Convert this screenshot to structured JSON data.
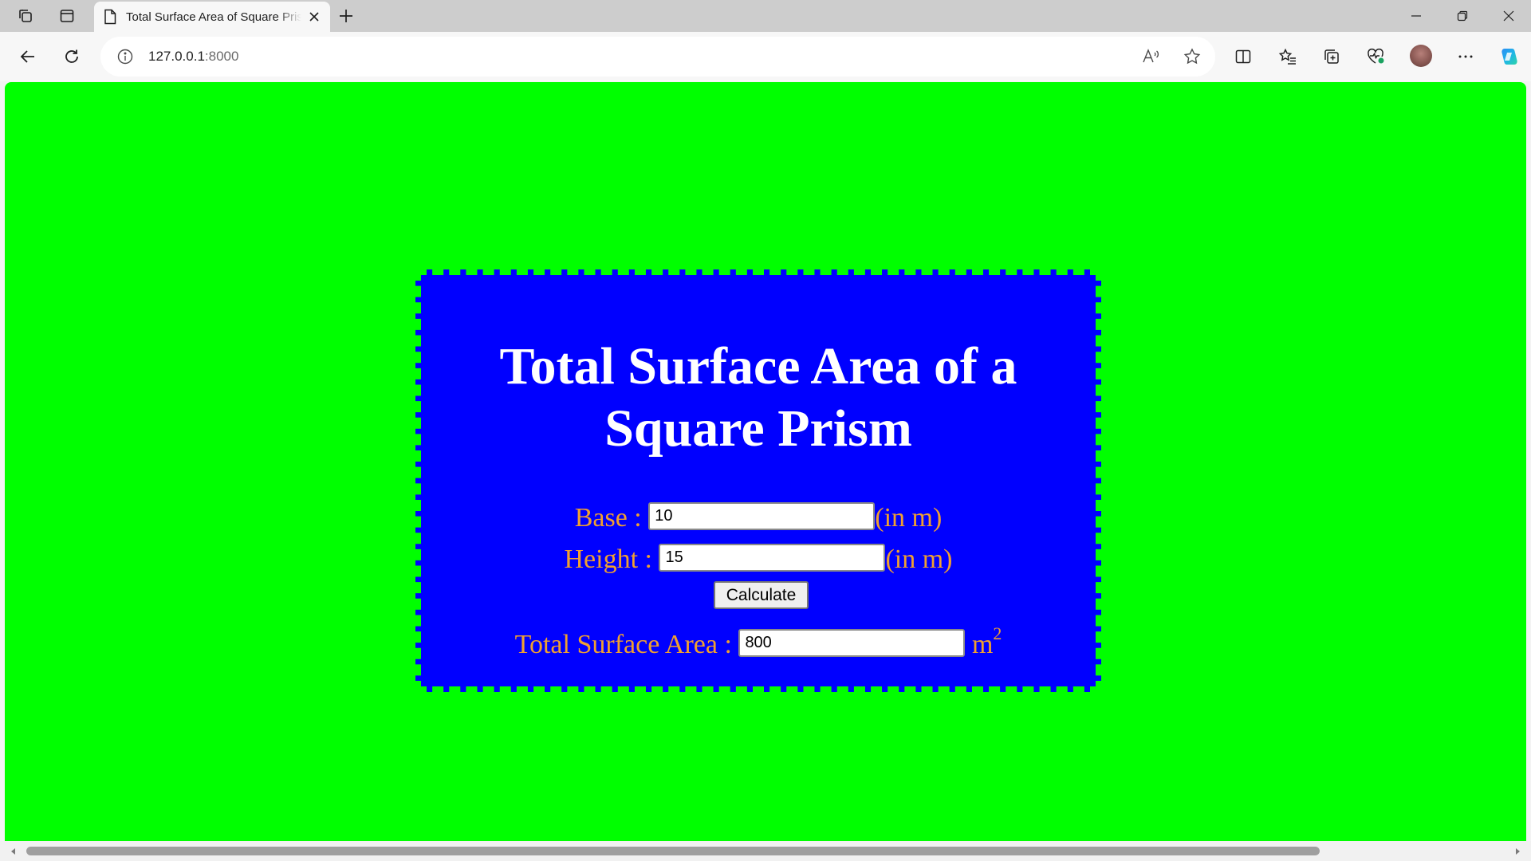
{
  "browser": {
    "tab_title": "Total Surface Area of Square Prism",
    "url_host": "127.0.0.1",
    "url_port": ":8000"
  },
  "page": {
    "heading": "Total Surface Area of a Square Prism",
    "base_label": "Base :",
    "base_value": "10",
    "height_label": "Height :",
    "height_value": "15",
    "unit": "(in m)",
    "calculate_label": "Calculate",
    "result_label": "Total Surface Area :",
    "result_value": "800",
    "result_unit": "m",
    "result_unit_exp": "2"
  },
  "colors": {
    "page_background": "#00ff00",
    "card_background": "#0000ff",
    "label_color": "#f0a030",
    "heading_color": "#ffffff"
  },
  "icons": [
    "workspaces-icon",
    "tab-actions-icon",
    "page-icon",
    "close-icon",
    "new-tab-icon",
    "minimize-icon",
    "restore-icon",
    "window-close-icon",
    "back-icon",
    "refresh-icon",
    "info-icon",
    "read-aloud-icon",
    "favorite-icon",
    "split-screen-icon",
    "favorites-icon",
    "collections-icon",
    "browser-essentials-icon",
    "more-icon",
    "copilot-icon"
  ]
}
